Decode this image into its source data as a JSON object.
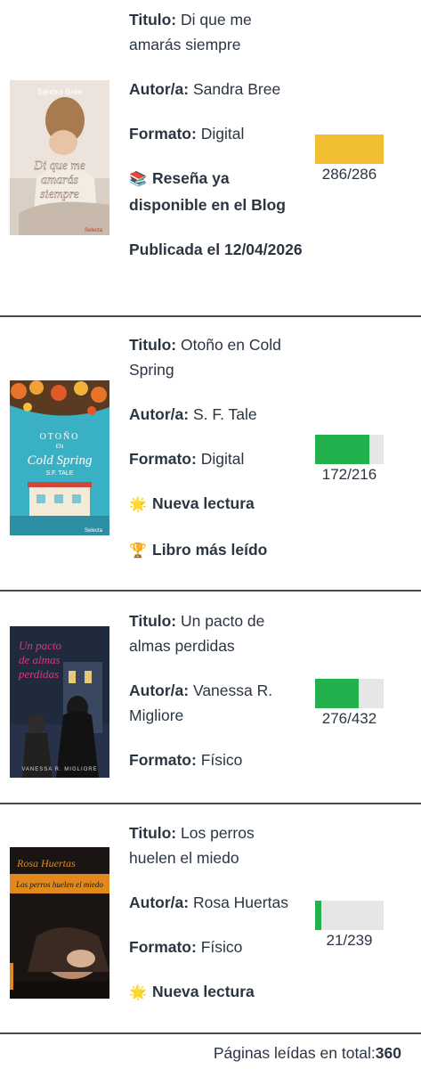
{
  "labels": {
    "titulo": "Titulo:",
    "autor": "Autor/a:",
    "formato": "Formato:"
  },
  "books": [
    {
      "title": "Di que me amarás siempre",
      "author": "Sandra Bree",
      "format": "Digital",
      "cover_text": {
        "author": "Sandra Bree",
        "title": "Di que me amarás siempre",
        "publisher": "Selecta"
      },
      "badges": [
        {
          "icon": "books-icon",
          "glyph": "📚",
          "text": "Reseña ya disponible en el Blog"
        }
      ],
      "published": "Publicada el 12/04/2026",
      "pages_read": 286,
      "pages_total": 286,
      "progress_text": "286/286",
      "progress_fraction": 1.0,
      "bar_color": "#f2bf33"
    },
    {
      "title": "Otoño en Cold Spring",
      "author": "S. F. Tale",
      "format": "Digital",
      "cover_text": {
        "title": "OTOÑO EN Cold Spring",
        "author": "S.F. TALE",
        "publisher": "Selecta"
      },
      "badges": [
        {
          "icon": "sparkle-icon",
          "glyph": "🌟",
          "text": "Nueva lectura"
        },
        {
          "icon": "trophy-icon",
          "glyph": "🏆",
          "text": "Libro más leído"
        }
      ],
      "pages_read": 172,
      "pages_total": 216,
      "progress_text": "172/216",
      "progress_fraction": 0.796,
      "bar_color": "#22b14c"
    },
    {
      "title": "Un pacto de almas perdidas",
      "author": "Vanessa R. Migliore",
      "format": "Físico",
      "cover_text": {
        "title": "Un pacto de almas perdidas",
        "author": "VANESSA R. MIGLIORE"
      },
      "badges": [],
      "pages_read": 276,
      "pages_total": 432,
      "progress_text": "276/432",
      "progress_fraction": 0.639,
      "bar_color": "#22b14c"
    },
    {
      "title": "Los perros huelen el miedo",
      "author": "Rosa Huertas",
      "format": "Físico",
      "cover_text": {
        "author": "Rosa Huertas",
        "title": "Los perros huelen el miedo"
      },
      "badges": [
        {
          "icon": "sparkle-icon",
          "glyph": "🌟",
          "text": "Nueva lectura"
        }
      ],
      "pages_read": 21,
      "pages_total": 239,
      "progress_text": "21/239",
      "progress_fraction": 0.088,
      "bar_color": "#22b14c"
    }
  ],
  "footer": {
    "total_label": "Páginas leídas en total:",
    "total_value": "360"
  },
  "colors": {
    "text": "#2b3542",
    "separator": "#4a4a4a",
    "bar_track": "#e6e6e6"
  }
}
